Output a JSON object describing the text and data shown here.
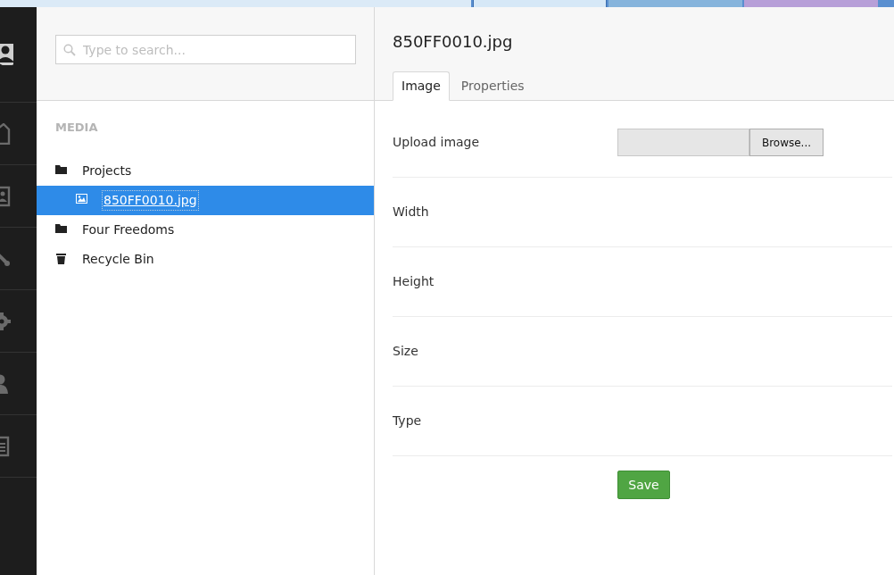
{
  "browser_tabs": [
    {
      "selected": false,
      "color": "#dbeaf7"
    },
    {
      "selected": true,
      "color": "#d6e8f7"
    },
    {
      "selected": false,
      "color": "#86b4dc"
    },
    {
      "selected": false,
      "color": "#b79fd8"
    }
  ],
  "nav": [
    {
      "kind": "avatar"
    },
    {
      "kind": "home"
    },
    {
      "kind": "card"
    },
    {
      "kind": "wrench"
    },
    {
      "kind": "gear"
    },
    {
      "kind": "user"
    },
    {
      "kind": "document"
    }
  ],
  "search": {
    "placeholder": "Type to search..."
  },
  "tree": {
    "heading": "MEDIA",
    "items": [
      {
        "kind": "folder",
        "label": "Projects",
        "selected": false,
        "children": [
          {
            "kind": "image",
            "label": "850FF0010.jpg",
            "selected": true
          }
        ]
      },
      {
        "kind": "folder",
        "label": "Four Freedoms",
        "selected": false
      },
      {
        "kind": "trash",
        "label": "Recycle Bin",
        "selected": false
      }
    ]
  },
  "editor": {
    "title": "850FF0010.jpg",
    "tabs": [
      {
        "label": "Image",
        "selected": true
      },
      {
        "label": "Properties",
        "selected": false
      }
    ],
    "fields": [
      {
        "kind": "upload",
        "label": "Upload image",
        "button": "Browse..."
      },
      {
        "kind": "plain",
        "label": "Width"
      },
      {
        "kind": "plain",
        "label": "Height"
      },
      {
        "kind": "plain",
        "label": "Size"
      },
      {
        "kind": "plain",
        "label": "Type"
      }
    ],
    "save": "Save"
  }
}
